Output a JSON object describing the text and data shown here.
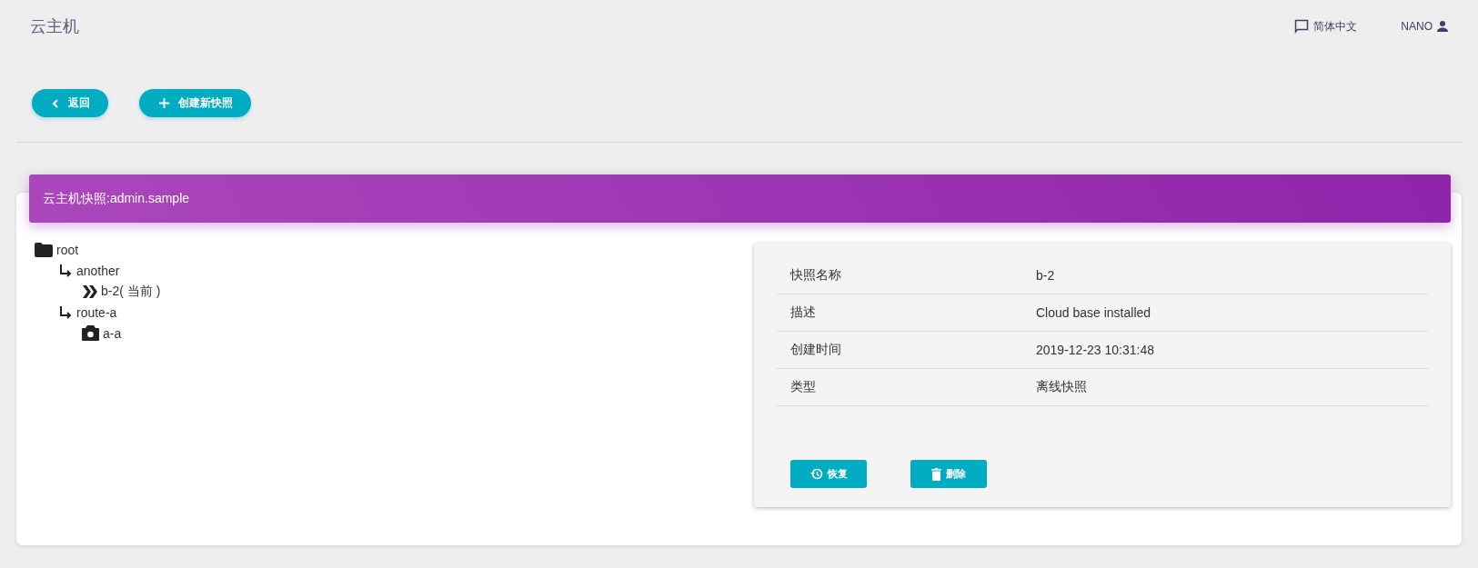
{
  "app_title": "云主机",
  "top_bar": {
    "language": "简体中文",
    "user": "NANO"
  },
  "actions": [
    {
      "kind": "back",
      "label": "返回"
    },
    {
      "kind": "create",
      "label": "创建新快照"
    }
  ],
  "card": {
    "title": "云主机快照:admin.sample",
    "tree": [
      {
        "kind": "folder",
        "label": "root",
        "children": [
          {
            "kind": "branch",
            "label": "another",
            "children": [
              {
                "kind": "current",
                "label": "b-2( 当前 )"
              }
            ]
          },
          {
            "kind": "branch",
            "label": "route-a",
            "children": [
              {
                "kind": "snapshot",
                "label": "a-a"
              }
            ]
          }
        ]
      }
    ],
    "details": [
      {
        "label": "快照名称",
        "value": "b-2"
      },
      {
        "label": "描述",
        "value": "Cloud base installed"
      },
      {
        "label": "创建时间",
        "value": "2019-12-23 10:31:48"
      },
      {
        "label": "类型",
        "value": "离线快照"
      }
    ],
    "buttons": [
      {
        "kind": "restore",
        "label": "恢复"
      },
      {
        "kind": "delete",
        "label": "删除"
      }
    ]
  }
}
